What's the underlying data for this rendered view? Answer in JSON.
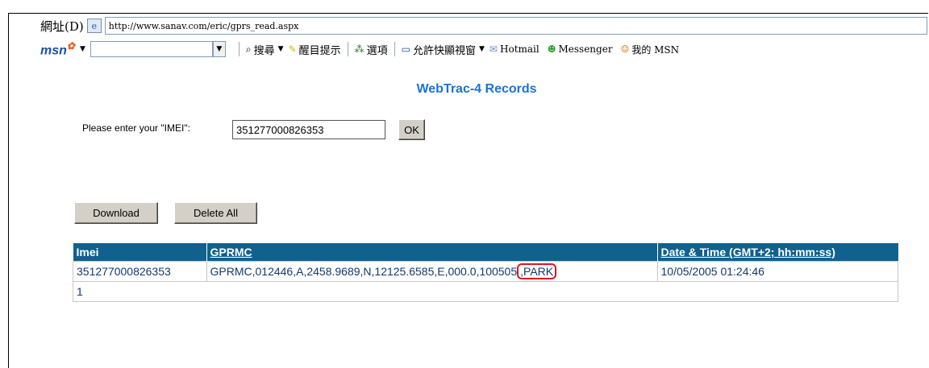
{
  "browser": {
    "address_label": "網址(D)",
    "address_url": "http://www.sanav.com/eric/gprs_read.aspx"
  },
  "msn_toolbar": {
    "logo": "msn",
    "search_label": "搜尋",
    "highlight_label": "醒目提示",
    "options_label": "選項",
    "popup_label": "允許快顯視窗",
    "hotmail_label": "Hotmail",
    "messenger_label": "Messenger",
    "my_msn_label": "我的 MSN"
  },
  "page": {
    "title": "WebTrac-4 Records",
    "imei_prompt": "Please enter your \"IMEI\":",
    "imei_value": "351277000826353",
    "ok_label": "OK",
    "download_label": "Download",
    "delete_all_label": "Delete All"
  },
  "table": {
    "headers": [
      "Imei",
      "GPRMC",
      "Date & Time (GMT+2; hh:mm:ss)"
    ],
    "rows": [
      {
        "imei": "351277000826353",
        "gprmc_main": "GPRMC,012446,A,2458.9689,N,12125.6585,E,000.0,100505",
        "gprmc_highlight": ",PARK",
        "datetime": "10/05/2005 01:24:46"
      }
    ],
    "page_number": "1"
  },
  "colors": {
    "title": "#1a73d6",
    "header_bg": "#10618e",
    "highlight_box": "#e0141e"
  }
}
